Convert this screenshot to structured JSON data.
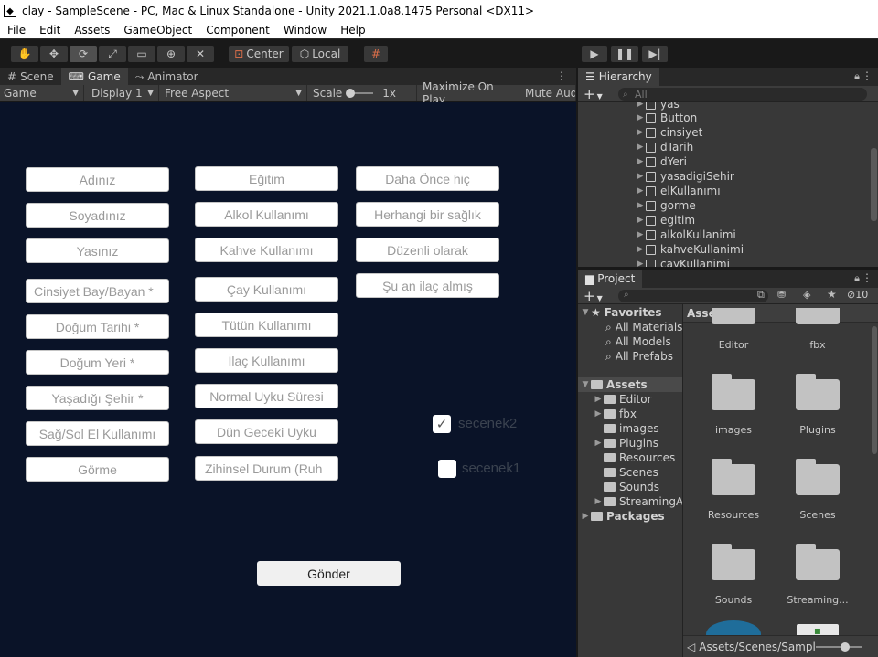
{
  "window": {
    "title": "clay - SampleScene - PC, Mac & Linux Standalone - Unity 2021.1.0a8.1475 Personal <DX11>"
  },
  "menu": [
    "File",
    "Edit",
    "Assets",
    "GameObject",
    "Component",
    "Window",
    "Help"
  ],
  "toolbar": {
    "center_label": "Center",
    "local_label": "Local"
  },
  "scene_tabs": [
    {
      "label": "Scene",
      "icon": "hash-icon"
    },
    {
      "label": "Game",
      "icon": "gamepad-icon"
    },
    {
      "label": "Animator",
      "icon": "animator-icon"
    }
  ],
  "gamebar": {
    "mode": "Game",
    "display": "Display 1",
    "aspect": "Free Aspect",
    "scale_label": "Scale",
    "scale_value": "1x",
    "maximize": "Maximize On Play",
    "mute": "Mute Aud"
  },
  "game": {
    "col1": [
      "Adınız",
      "Soyadınız",
      "Yasınız",
      "Cinsiyet Bay/Bayan *",
      "Doğum Tarihi *",
      "Doğum Yeri *",
      "Yaşadığı Şehir *",
      "Sağ/Sol El Kullanımı",
      "Görme"
    ],
    "col2": [
      "Eğitim",
      "Alkol Kullanımı",
      "Kahve Kullanımı",
      "Çay Kullanımı",
      "Tütün Kullanımı",
      "İlaç Kullanımı",
      "Normal Uyku Süresi",
      "Dün Geceki Uyku",
      "Zihinsel Durum (Ruh"
    ],
    "col3": [
      "Daha Önce hiç",
      "Herhangi bir sağlık",
      "Düzenli olarak",
      "Şu an ilaç almış"
    ],
    "checkboxes": [
      {
        "label": "secenek2",
        "checked": true
      },
      {
        "label": "secenek1",
        "checked": false
      }
    ],
    "submit": "Gönder"
  },
  "hierarchy": {
    "tab": "Hierarchy",
    "search_placeholder": "All",
    "items": [
      "yas",
      "Button",
      "cinsiyet",
      "dTarih",
      "dYeri",
      "yasadigiSehir",
      "elKullanımı",
      "gorme",
      "egitim",
      "alkolKullanimi",
      "kahveKullanimi",
      "cayKullanimi"
    ]
  },
  "project": {
    "tab": "Project",
    "hidden_count": "10",
    "favorites_label": "Favorites",
    "favorites": [
      "All Materials",
      "All Models",
      "All Prefabs"
    ],
    "assets_label": "Assets",
    "asset_folders": [
      "Editor",
      "fbx",
      "images",
      "Plugins",
      "Resources",
      "Scenes",
      "Sounds",
      "StreamingA"
    ],
    "packages_label": "Packages",
    "grid_header": "Assets",
    "grid_top": [
      "Editor",
      "fbx"
    ],
    "grid_items": [
      "images",
      "Plugins",
      "Resources",
      "Scenes",
      "Sounds",
      "Streaming..."
    ],
    "path": "Assets/Scenes/Sampl"
  }
}
